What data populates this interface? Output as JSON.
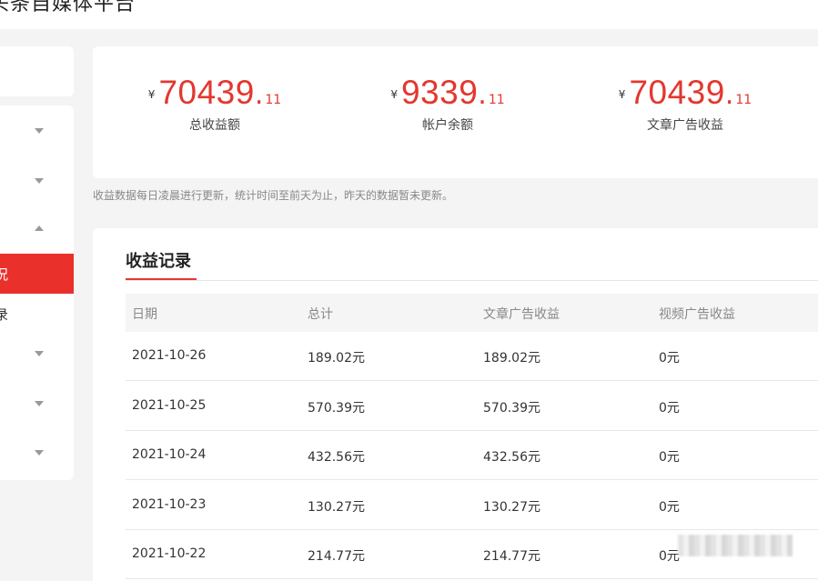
{
  "header": {
    "brand": "头条自媒体平台"
  },
  "sidebar": {
    "items": [
      {
        "label": "",
        "state": "collapsed"
      },
      {
        "label": "",
        "state": "collapsed"
      },
      {
        "label": "",
        "state": "expanded"
      },
      {
        "label": "收益概况",
        "active": true
      },
      {
        "label": "收益记录"
      },
      {
        "label": "",
        "state": "collapsed"
      },
      {
        "label": "",
        "state": "collapsed"
      },
      {
        "label": "",
        "state": "collapsed"
      }
    ],
    "active_label": "况",
    "sub_label": "录"
  },
  "stats": [
    {
      "currency": "¥",
      "integer": "70439",
      "dot": ".",
      "cents": "11",
      "label": "总收益额"
    },
    {
      "currency": "¥",
      "integer": "9339",
      "dot": ".",
      "cents": "11",
      "label": "帐户余额"
    },
    {
      "currency": "¥",
      "integer": "70439",
      "dot": ".",
      "cents": "11",
      "label": "文章广告收益"
    }
  ],
  "note": "收益数据每日凌晨进行更新，统计时间至前天为止，昨天的数据暂未更新。",
  "records": {
    "title": "收益记录",
    "columns": [
      "日期",
      "总计",
      "文章广告收益",
      "视频广告收益"
    ],
    "rows": [
      [
        "2021-10-26",
        "189.02元",
        "189.02元",
        "0元"
      ],
      [
        "2021-10-25",
        "570.39元",
        "570.39元",
        "0元"
      ],
      [
        "2021-10-24",
        "432.56元",
        "432.56元",
        "0元"
      ],
      [
        "2021-10-23",
        "130.27元",
        "130.27元",
        "0元"
      ],
      [
        "2021-10-22",
        "214.77元",
        "214.77元",
        "0元"
      ]
    ]
  },
  "colors": {
    "accent": "#e3372f",
    "active_menu": "#e9302b",
    "background": "#f4f4f4"
  }
}
